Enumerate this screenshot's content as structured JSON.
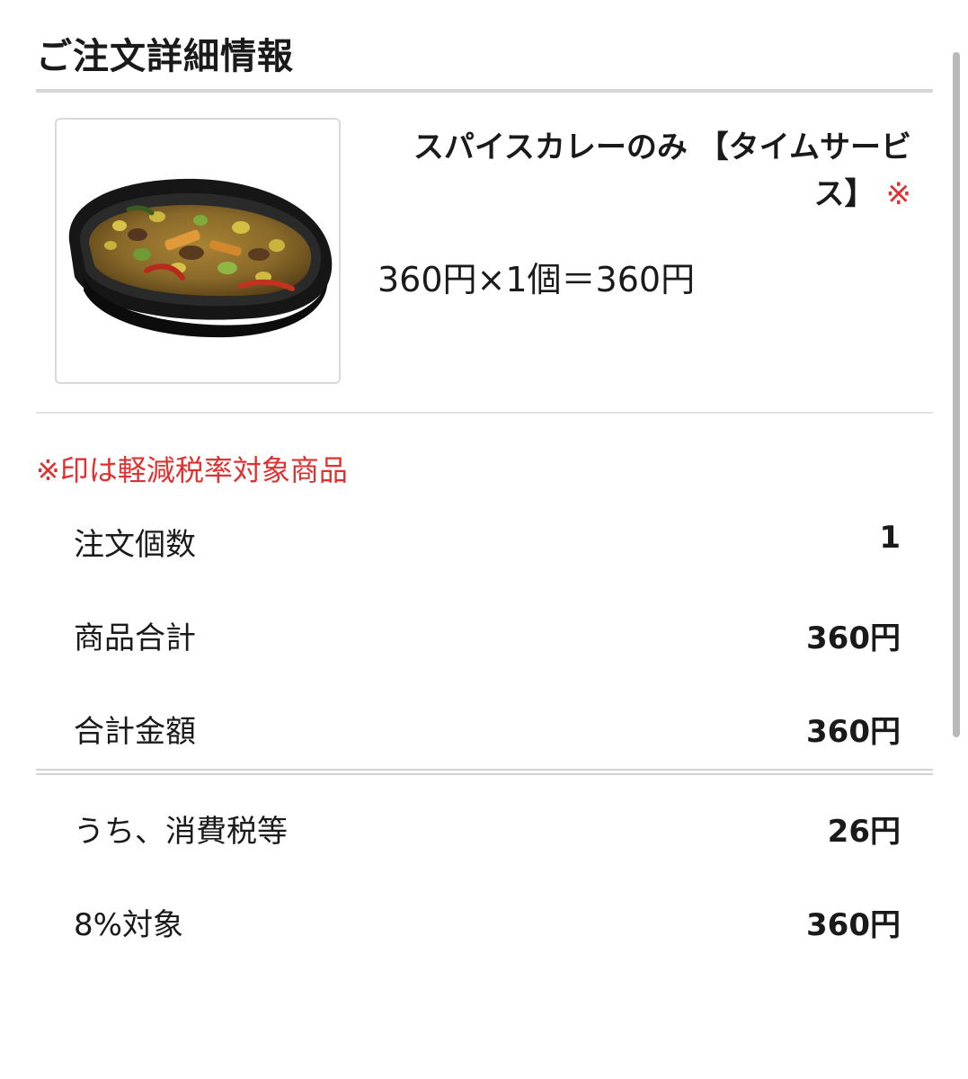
{
  "header": {
    "title": "ご注文詳細情報"
  },
  "product": {
    "image_alt_icon": "spice-curry-photo",
    "name": "スパイスカレーのみ 【タイムサービス】",
    "reduced_tax_mark": "※",
    "price_line": "360円×1個＝360円"
  },
  "notice": {
    "reduced_tax_note": "※印は軽減税率対象商品"
  },
  "summary": {
    "order_count_label": "注文個数",
    "order_count_value": "1",
    "subtotal_label": "商品合計",
    "subtotal_value": "360円",
    "total_label": "合計金額",
    "total_value": "360円"
  },
  "tax": {
    "included_tax_label": "うち、消費税等",
    "included_tax_value": "26円",
    "rate8_label": "8%対象",
    "rate8_value": "360円"
  },
  "colors": {
    "accent_red": "#e03131",
    "divider": "#d6d6d6"
  }
}
